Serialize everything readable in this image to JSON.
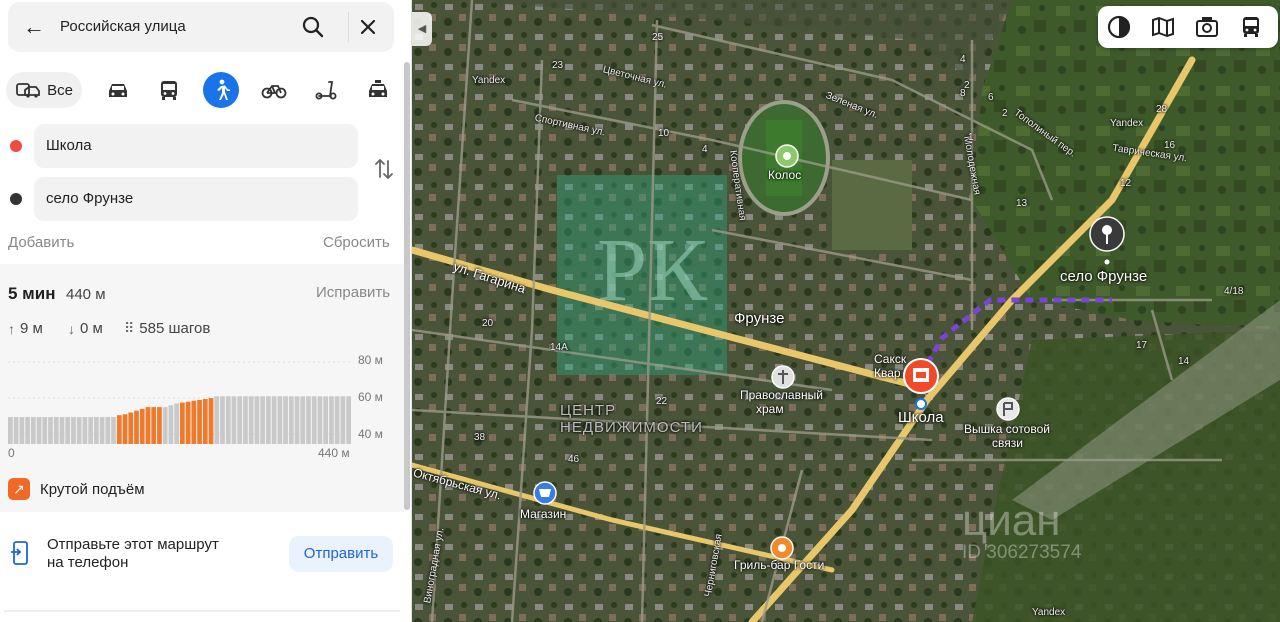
{
  "search": {
    "query": "Российская улица"
  },
  "modes": {
    "all_label": "Все"
  },
  "route_points": {
    "from": "Школа",
    "to": "село Фрунзе"
  },
  "actions": {
    "add": "Добавить",
    "reset": "Сбросить"
  },
  "route": {
    "time": "5 мин",
    "distance": "440 м",
    "edit": "Исправить",
    "ascent": "9 м",
    "descent": "0 м",
    "steps": "585 шагов"
  },
  "elevation": {
    "y_labels": [
      "80 м",
      "60 м",
      "40 м"
    ],
    "x_start": "0",
    "x_end": "440 м",
    "bars": [
      0.3,
      0.3,
      0.3,
      0.3,
      0.3,
      0.3,
      0.3,
      0.3,
      0.3,
      0.3,
      0.3,
      0.3,
      0.3,
      0.3,
      0.3,
      0.3,
      0.3,
      0.3,
      0.3,
      0.32,
      0.33,
      0.35,
      0.37,
      0.39,
      0.41,
      0.41,
      0.41,
      0.41,
      0.43,
      0.45,
      0.46,
      0.47,
      0.48,
      0.49,
      0.5,
      0.51,
      0.53,
      0.53,
      0.53,
      0.53,
      0.53,
      0.53,
      0.53,
      0.53,
      0.53,
      0.53,
      0.53,
      0.53,
      0.53,
      0.53,
      0.53,
      0.53,
      0.53,
      0.53,
      0.53,
      0.53,
      0.53,
      0.53,
      0.53,
      0.53
    ],
    "steep_ranges": [
      [
        19,
        26
      ],
      [
        30,
        35
      ]
    ],
    "colors": {
      "normal": "#c9c9c9",
      "steep": "#f07a2b"
    }
  },
  "steep_climb": "Крутой подъём",
  "send": {
    "line1": "Отправьте этот маршрут",
    "line2": "на телефон",
    "button": "Отправить"
  },
  "map": {
    "labels": {
      "frunze_village": "село Фрунзе",
      "frunze_town": "Фрунзе",
      "kolos": "Колос",
      "school": "Школа",
      "church_1": "Православный",
      "church_2": "храм",
      "tower_1": "Вышка сотовой",
      "tower_2": "связи",
      "shop": "Магазин",
      "grill": "Гриль-бар Гости",
      "sak_1": "Сакск",
      "sak_2": "Квар",
      "watermark_center": "ЦЕНТР НЕДВИЖИМОСТИ",
      "cian": "циан",
      "cian_id": "ID 306273574",
      "yandex_1": "Yandex",
      "yandex_2": "Yandex",
      "yandex_3": "Yandex",
      "street_gagarina": "ул. Гагарина",
      "street_oktyabrskaya": "Октябрьская ул.",
      "street_sportivnaya": "Спортивная ул.",
      "street_tsvetochnaya": "Цветочная ул.",
      "street_zelenaya": "Зеленая ул.",
      "street_tavricheskaya": "Таврическая ул.",
      "street_topolnyi": "Тополиный пер.",
      "street_molodezhnaya": "Молодежная",
      "street_vinogradnaya": "Виноградная ул.",
      "street_chernigovskaya": "Черниговская",
      "street_kooperativnaya": "Кооперативная"
    },
    "house_numbers": [
      "25",
      "23",
      "10",
      "4",
      "28",
      "16",
      "17",
      "14",
      "4/18",
      "13",
      "12",
      "2",
      "8",
      "20",
      "22",
      "14А",
      "38",
      "46",
      "2",
      "4",
      "1",
      "6"
    ],
    "colors": {
      "route": "#7b44d8",
      "marker": "#f04a2a",
      "road": "#e8c66a",
      "ground": "#3d4a2b"
    }
  }
}
